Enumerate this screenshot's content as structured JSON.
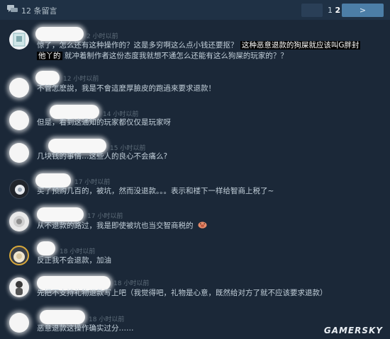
{
  "header": {
    "comment_count": "12 条留言",
    "pages": [
      "1",
      "2"
    ],
    "current_page": "2",
    "next_label": ">"
  },
  "comments": [
    {
      "time": "2 小时以前",
      "text_part1": "惊了，怎么还有这种操作的？这是多穷啊这么点小钱还要抠？",
      "highlight_line1": "这种恶意退款的狗屎就应该叫G胖封",
      "highlight_line2": "他丫的",
      "text_part2": "就冲着制作者这份态度我就想不通怎么还能有这么狗屎的玩家的？？"
    },
    {
      "time": "12 小时以前",
      "text": "不管怎麽說，我是不會這麼厚臉皮的跑過來要求退款！"
    },
    {
      "time": "14 小时以前",
      "text": "但是，看到这通知的玩家都仅仅是玩家呀"
    },
    {
      "time": "15 小时以前",
      "text": "几块钱的事情…这些人的良心不会痛么?"
    },
    {
      "time": "17 小时以前",
      "text": "买了预购几百的，被坑，然而没退款。。。表示和楼下一样给智商上税了~"
    },
    {
      "time": "17 小时以前",
      "text": "从不退款的路过，我是即使被坑也当交智商税的"
    },
    {
      "time": "18 小时以前",
      "text": "反正我不会退款，加油"
    },
    {
      "time": "18 小时以前",
      "text": "先把不支持礼物退款写上吧（我觉得吧，礼物是心意，既然给对方了就不应该要求退款）"
    },
    {
      "time": "18 小时以前",
      "text": "恶意退款这操作确实过分……"
    }
  ],
  "watermark": "GAMERSKY",
  "colors": {
    "background": "#1b2838",
    "header": "#1f3145",
    "next_button": "#4c7ea7",
    "timestamp": "#5f6e7b",
    "comment_text": "#c3d0da"
  },
  "icons": {
    "header_icon": "chat-bubbles-icon",
    "emoji": "pig-face-emoji"
  }
}
